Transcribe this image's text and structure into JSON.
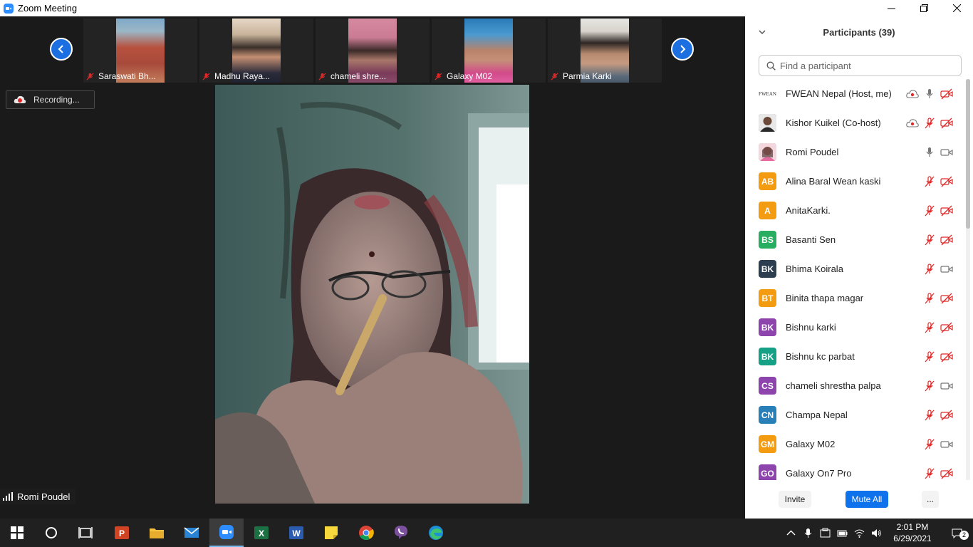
{
  "window": {
    "title": "Zoom Meeting"
  },
  "thumbnails": [
    {
      "name": "Saraswati Bh..."
    },
    {
      "name": "Madhu Raya..."
    },
    {
      "name": "chameli shre..."
    },
    {
      "name": "Galaxy M02"
    },
    {
      "name": "Parmia Karki"
    }
  ],
  "recording": {
    "label": "Recording..."
  },
  "active_speaker": {
    "name": "Romi Poudel"
  },
  "participants_panel": {
    "title": "Participants (39)",
    "search_placeholder": "Find a participant",
    "participants": [
      {
        "name": "FWEAN Nepal (Host, me)",
        "avatar_text": "FWEAN",
        "avatar_color": "#ffffff",
        "recording": true,
        "mic": "on",
        "video": "off"
      },
      {
        "name": "Kishor Kuikel (Co-host)",
        "avatar_text": "",
        "avatar_color": "#6b4a3a",
        "recording": true,
        "mic": "off",
        "video": "off"
      },
      {
        "name": "Romi Poudel",
        "avatar_text": "",
        "avatar_color": "#d9a0a8",
        "recording": false,
        "mic": "on",
        "video": "on"
      },
      {
        "name": "Alina Baral Wean kaski",
        "avatar_text": "AB",
        "avatar_color": "#f39c12",
        "recording": false,
        "mic": "off",
        "video": "off"
      },
      {
        "name": "AnitaKarki.",
        "avatar_text": "A",
        "avatar_color": "#f39c12",
        "recording": false,
        "mic": "off",
        "video": "off"
      },
      {
        "name": "Basanti Sen",
        "avatar_text": "BS",
        "avatar_color": "#27ae60",
        "recording": false,
        "mic": "off",
        "video": "off"
      },
      {
        "name": "Bhima Koirala",
        "avatar_text": "BK",
        "avatar_color": "#2c3e50",
        "recording": false,
        "mic": "off",
        "video": "on"
      },
      {
        "name": "Binita thapa magar",
        "avatar_text": "BT",
        "avatar_color": "#f39c12",
        "recording": false,
        "mic": "off",
        "video": "off"
      },
      {
        "name": "Bishnu karki",
        "avatar_text": "BK",
        "avatar_color": "#8e44ad",
        "recording": false,
        "mic": "off",
        "video": "off"
      },
      {
        "name": "Bishnu kc parbat",
        "avatar_text": "BK",
        "avatar_color": "#16a085",
        "recording": false,
        "mic": "off",
        "video": "off"
      },
      {
        "name": "chameli shrestha palpa",
        "avatar_text": "CS",
        "avatar_color": "#8e44ad",
        "recording": false,
        "mic": "off",
        "video": "on"
      },
      {
        "name": "Champa Nepal",
        "avatar_text": "CN",
        "avatar_color": "#2980b9",
        "recording": false,
        "mic": "off",
        "video": "off"
      },
      {
        "name": "Galaxy M02",
        "avatar_text": "GM",
        "avatar_color": "#f39c12",
        "recording": false,
        "mic": "off",
        "video": "on"
      },
      {
        "name": "Galaxy On7 Pro",
        "avatar_text": "GO",
        "avatar_color": "#8e44ad",
        "recording": false,
        "mic": "off",
        "video": "off"
      }
    ],
    "invite_label": "Invite",
    "mute_all_label": "Mute All",
    "more_label": "..."
  },
  "taskbar": {
    "apps": [
      "windows-start",
      "search",
      "task-view",
      "powerpoint",
      "file-explorer",
      "mail",
      "zoom",
      "excel",
      "word",
      "sticky-notes",
      "chrome",
      "viber",
      "edge"
    ],
    "active_app": "zoom",
    "time": "2:01 PM",
    "date": "6/29/2021",
    "notification_count": "2"
  },
  "colors": {
    "accent": "#0e72ed",
    "nav_arrow": "#1b6fe0",
    "muted": "#e02828"
  }
}
